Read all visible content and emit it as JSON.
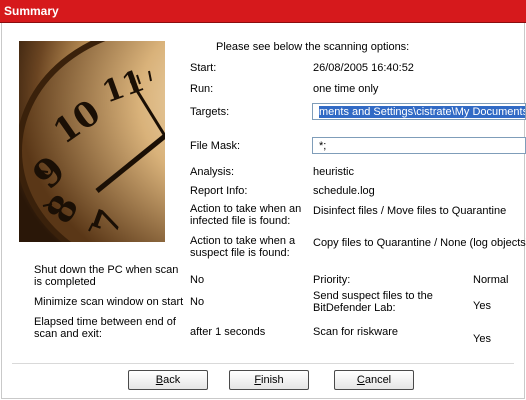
{
  "window": {
    "title": "Summary"
  },
  "intro": "Please see below the scanning options:",
  "options": {
    "start": {
      "label": "Start:",
      "value": "26/08/2005 16:40:52"
    },
    "run": {
      "label": "Run:",
      "value": "one time only"
    },
    "targets": {
      "label": "Targets:",
      "value": "ments and Settings\\cistrate\\My Documents"
    },
    "file_mask": {
      "label": "File Mask:",
      "value": "*;"
    },
    "analysis": {
      "label": "Analysis:",
      "value": "heuristic"
    },
    "report_info": {
      "label": "Report Info:",
      "value": "schedule.log"
    },
    "infected_action": {
      "label": "Action to take when an infected file is found:",
      "value": "Disinfect files / Move files to Quarantine"
    },
    "suspect_action": {
      "label": "Action to take when a suspect file is found:",
      "value": "Copy files to Quarantine / None (log objects)"
    }
  },
  "settings": {
    "shutdown": {
      "label": "Shut down the PC when scan is completed",
      "value": "No"
    },
    "minimize": {
      "label": "Minimize scan window on start",
      "value": "No"
    },
    "elapsed": {
      "label": "Elapsed time between end of scan and exit:",
      "value": "after 1 seconds"
    },
    "priority": {
      "label": "Priority:",
      "value": "Normal"
    },
    "send_suspect": {
      "label": "Send suspect files to the BitDefender Lab:",
      "value": "Yes"
    },
    "riskware": {
      "label": "Scan for riskware",
      "value": "Yes"
    }
  },
  "buttons": {
    "back": {
      "mnemonic": "B",
      "rest": "ack"
    },
    "finish": {
      "mnemonic": "F",
      "rest": "inish"
    },
    "cancel": {
      "mnemonic": "C",
      "rest": "ancel"
    }
  },
  "colors": {
    "title_bar": "#d6191c",
    "selection": "#316ac5"
  },
  "icons": {
    "clock_image": "wall-clock-photo"
  }
}
